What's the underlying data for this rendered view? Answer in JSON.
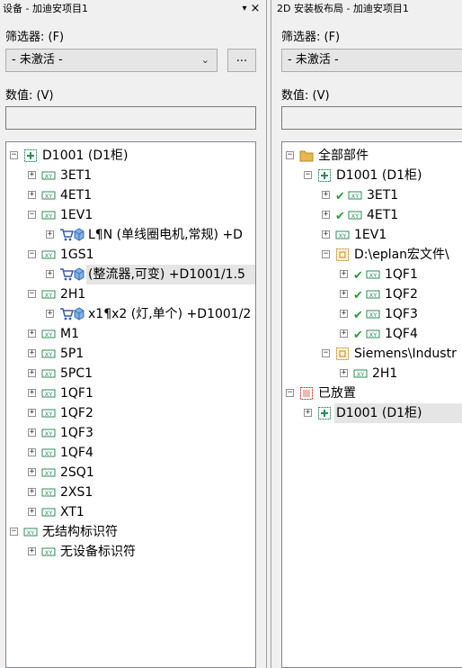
{
  "left_panel": {
    "title": "设备 - 加迪安项目1",
    "pin_glyph": "▾",
    "close_glyph": "×",
    "filter_label": "筛选器: (F)",
    "filter_value": "- 未激活 -",
    "more_button": "...",
    "value_label": "数值: (V)",
    "tree": [
      {
        "label": "D1001 (D1柜)",
        "icon": "location-box-icon",
        "expander": "−"
      },
      {
        "label": "3ET1",
        "icon": "xy-device-icon",
        "expander": "+"
      },
      {
        "label": "4ET1",
        "icon": "xy-device-icon",
        "expander": "+"
      },
      {
        "label": "1EV1",
        "icon": "xy-device-icon",
        "expander": "−"
      },
      {
        "label": "L¶N (单线圈电机,常规) +D",
        "icon": "cart-part-icon",
        "expander": "+"
      },
      {
        "label": "1GS1",
        "icon": "xy-device-icon",
        "expander": "−"
      },
      {
        "label": "(整流器,可变) +D1001/1.5",
        "icon": "cart-part-icon",
        "expander": "+"
      },
      {
        "label": "2H1",
        "icon": "xy-device-icon",
        "expander": "−"
      },
      {
        "label": "x1¶x2 (灯,单个) +D1001/2",
        "icon": "cart-part-icon",
        "expander": "+"
      },
      {
        "label": "M1",
        "icon": "xy-device-icon",
        "expander": "+"
      },
      {
        "label": "5P1",
        "icon": "xy-device-icon",
        "expander": "+"
      },
      {
        "label": "5PC1",
        "icon": "xy-device-icon",
        "expander": "+"
      },
      {
        "label": "1QF1",
        "icon": "xy-device-icon",
        "expander": "+"
      },
      {
        "label": "1QF2",
        "icon": "xy-device-icon",
        "expander": "+"
      },
      {
        "label": "1QF3",
        "icon": "xy-device-icon",
        "expander": "+"
      },
      {
        "label": "1QF4",
        "icon": "xy-device-icon",
        "expander": "+"
      },
      {
        "label": "2SQ1",
        "icon": "xy-device-icon",
        "expander": "+"
      },
      {
        "label": "2XS1",
        "icon": "xy-device-icon",
        "expander": "+"
      },
      {
        "label": "XT1",
        "icon": "xy-device-icon",
        "expander": "+"
      },
      {
        "label": "无结构标识符",
        "icon": "xy-device-icon",
        "expander": "−"
      },
      {
        "label": "无设备标识符",
        "icon": "xy-device-icon",
        "expander": "+"
      }
    ]
  },
  "right_panel": {
    "title": "2D 安装板布局 - 加迪安项目1",
    "filter_label": "筛选器: (F)",
    "filter_value": "- 未激活 -",
    "value_label": "数值: (V)",
    "tree": [
      {
        "label": "全部部件",
        "icon": "folder-icon",
        "expander": "−"
      },
      {
        "label": "D1001 (D1柜)",
        "icon": "location-box-icon",
        "expander": "−"
      },
      {
        "label": "3ET1",
        "icon": "xy-device-icon",
        "expander": "+",
        "check": "✔"
      },
      {
        "label": "4ET1",
        "icon": "xy-device-icon",
        "expander": "+",
        "check": "✔"
      },
      {
        "label": "1EV1",
        "icon": "xy-device-icon",
        "expander": "+"
      },
      {
        "label": "D:\\eplan宏文件\\",
        "icon": "macro-box-icon",
        "expander": "−"
      },
      {
        "label": "1QF1",
        "icon": "xy-device-icon",
        "expander": "+",
        "check": "✔"
      },
      {
        "label": "1QF2",
        "icon": "xy-device-icon",
        "expander": "+",
        "check": "✔"
      },
      {
        "label": "1QF3",
        "icon": "xy-device-icon",
        "expander": "+",
        "check": "✔"
      },
      {
        "label": "1QF4",
        "icon": "xy-device-icon",
        "expander": "+",
        "check": "✔"
      },
      {
        "label": "Siemens\\Industr",
        "icon": "macro-box-icon",
        "expander": "−"
      },
      {
        "label": "2H1",
        "icon": "xy-device-icon",
        "expander": "+"
      },
      {
        "label": "已放置",
        "icon": "placed-box-icon",
        "expander": "−"
      },
      {
        "label": "D1001 (D1柜)",
        "icon": "location-box-icon",
        "expander": "+"
      }
    ]
  },
  "colors": {
    "xy_icon": "#2e8b57",
    "check": "#2e9a3c",
    "folder": "#e8b64c",
    "location_icon": "#2e8b57",
    "placed_icon": "#c0392b",
    "selection": "#e5e5e5"
  }
}
